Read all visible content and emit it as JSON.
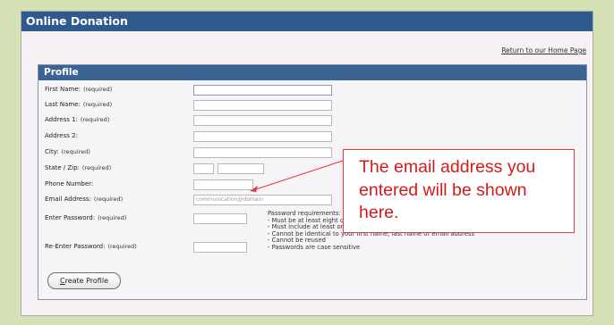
{
  "window": {
    "title": "Online Donation",
    "home_link": "Return to our Home Page"
  },
  "profile": {
    "header": "Profile",
    "fields": [
      {
        "label": "First Name:",
        "required": "(required)"
      },
      {
        "label": "Last Name:",
        "required": "(required)"
      },
      {
        "label": "Address 1:",
        "required": "(required)"
      },
      {
        "label": "Address 2:",
        "required": ""
      },
      {
        "label": "City:",
        "required": "(required)"
      },
      {
        "label": "State / Zip:",
        "required": "(required)"
      },
      {
        "label": "Phone Number:",
        "required": ""
      },
      {
        "label": "Email Address:",
        "required": "(required)"
      },
      {
        "label": "Enter Password:",
        "required": "(required)"
      },
      {
        "label": "Re-Enter Password:",
        "required": "(required)"
      }
    ],
    "email_value": "communication@domain",
    "password_requirements": [
      "Password requirements:",
      "- Must be at least eight characters",
      "- Must include at least one number",
      "- Cannot be identical to your first name, last name or email address",
      "- Cannot be reused",
      "- Passwords are case sensitive"
    ],
    "create_button": {
      "underlined": "C",
      "rest": "reate Profile"
    }
  },
  "callout": {
    "text": "The email address you entered will be shown here.",
    "border_color": "#e03b3b",
    "text_color": "#d31b1b"
  },
  "colors": {
    "page_background": "#d3e1b5",
    "title_bar": "#2f5a8f",
    "profile_header": "#3a6494"
  }
}
